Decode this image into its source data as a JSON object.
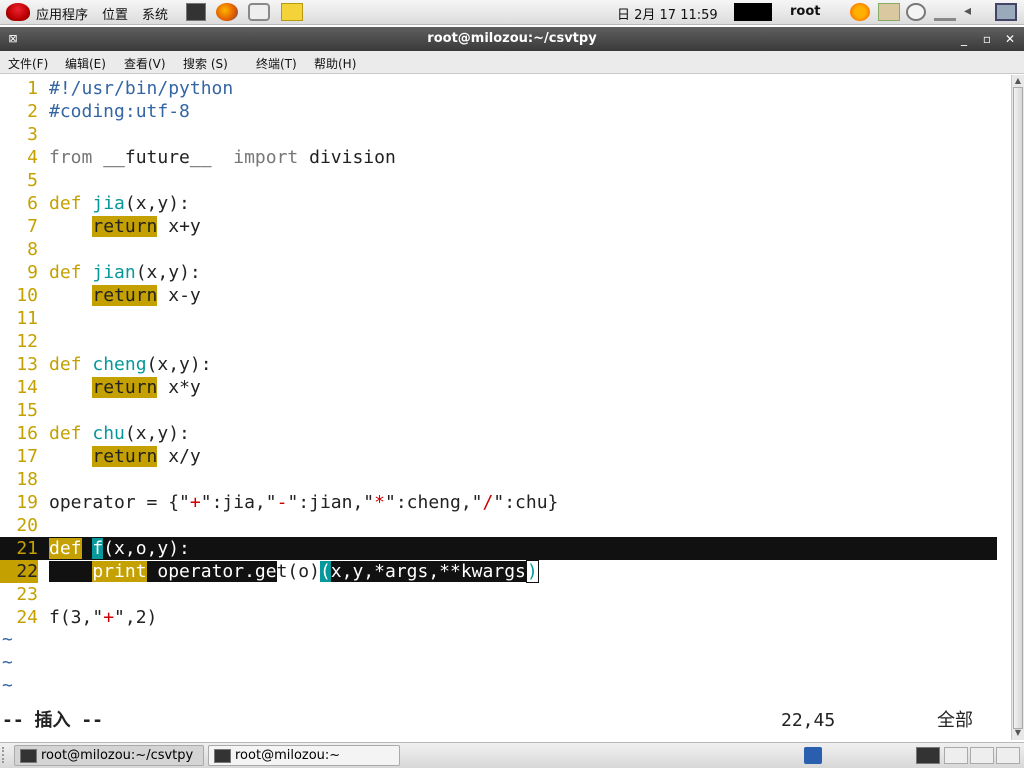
{
  "top_panel": {
    "applications": "应用程序",
    "places": "位置",
    "system": "系统",
    "clock": "日 2月 17 11:59",
    "user": "root"
  },
  "window": {
    "title": "root@milozou:~/csvtpy",
    "minimize": "_",
    "maximize": "▫",
    "close": "✕"
  },
  "menubar": {
    "file": "文件(F)",
    "edit": "编辑(E)",
    "view": "查看(V)",
    "search": "搜索 (S)",
    "terminal": "终端(T)",
    "help": "帮助(H)"
  },
  "editor": {
    "lines": {
      "l1": {
        "n": "1",
        "a": "#!/usr/bin/python"
      },
      "l2": {
        "n": "2",
        "a": "#coding:utf-8"
      },
      "l3": {
        "n": "3"
      },
      "l4": {
        "n": "4",
        "a": "from",
        "b": " __future__  ",
        "c": "import",
        "d": " division"
      },
      "l5": {
        "n": "5"
      },
      "l6": {
        "n": "6",
        "a": "def",
        "b": " ",
        "c": "jia",
        "d": "(x,y):"
      },
      "l7": {
        "n": "7",
        "a": "    ",
        "b": "return",
        "c": " x+y"
      },
      "l8": {
        "n": "8"
      },
      "l9": {
        "n": "9",
        "a": "def",
        "b": " ",
        "c": "jian",
        "d": "(x,y):"
      },
      "l10": {
        "n": "10",
        "a": "    ",
        "b": "return",
        "c": " x-y"
      },
      "l11": {
        "n": "11"
      },
      "l12": {
        "n": "12"
      },
      "l13": {
        "n": "13",
        "a": "def",
        "b": " ",
        "c": "cheng",
        "d": "(x,y):"
      },
      "l14": {
        "n": "14",
        "a": "    ",
        "b": "return",
        "c": " x*y"
      },
      "l15": {
        "n": "15"
      },
      "l16": {
        "n": "16",
        "a": "def",
        "b": " ",
        "c": "chu",
        "d": "(x,y):"
      },
      "l17": {
        "n": "17",
        "a": "    ",
        "b": "return",
        "c": " x/y"
      },
      "l18": {
        "n": "18"
      },
      "l19": {
        "n": "19",
        "p1": "operator = {\"",
        "s1": "+",
        "p2": "\":jia,\"",
        "s2": "-",
        "p3": "\":jian,\"",
        "s3": "*",
        "p4": "\":cheng,\"",
        "s4": "/",
        "p5": "\":chu}"
      },
      "l20": {
        "n": "20"
      },
      "l21": {
        "n": "21",
        "a": "def",
        "b": " ",
        "c": "f",
        "d": "(x,o,y):"
      },
      "l22": {
        "n": "22",
        "a": "    ",
        "b": "print",
        "c": " operator.ge",
        "d": "t(o)",
        "e": "(",
        "f": "x,y,*args,**kwargs",
        "g": ")"
      },
      "l23": {
        "n": "23"
      },
      "l24": {
        "n": "24",
        "a": "f(3,\"",
        "b": "+",
        "c": "\",2)"
      }
    },
    "tilde": "~",
    "mode": "-- 插入 --",
    "position": "22,45",
    "scroll": "全部"
  },
  "taskbar": {
    "task1": "root@milozou:~/csvtpy",
    "task2": "root@milozou:~"
  }
}
